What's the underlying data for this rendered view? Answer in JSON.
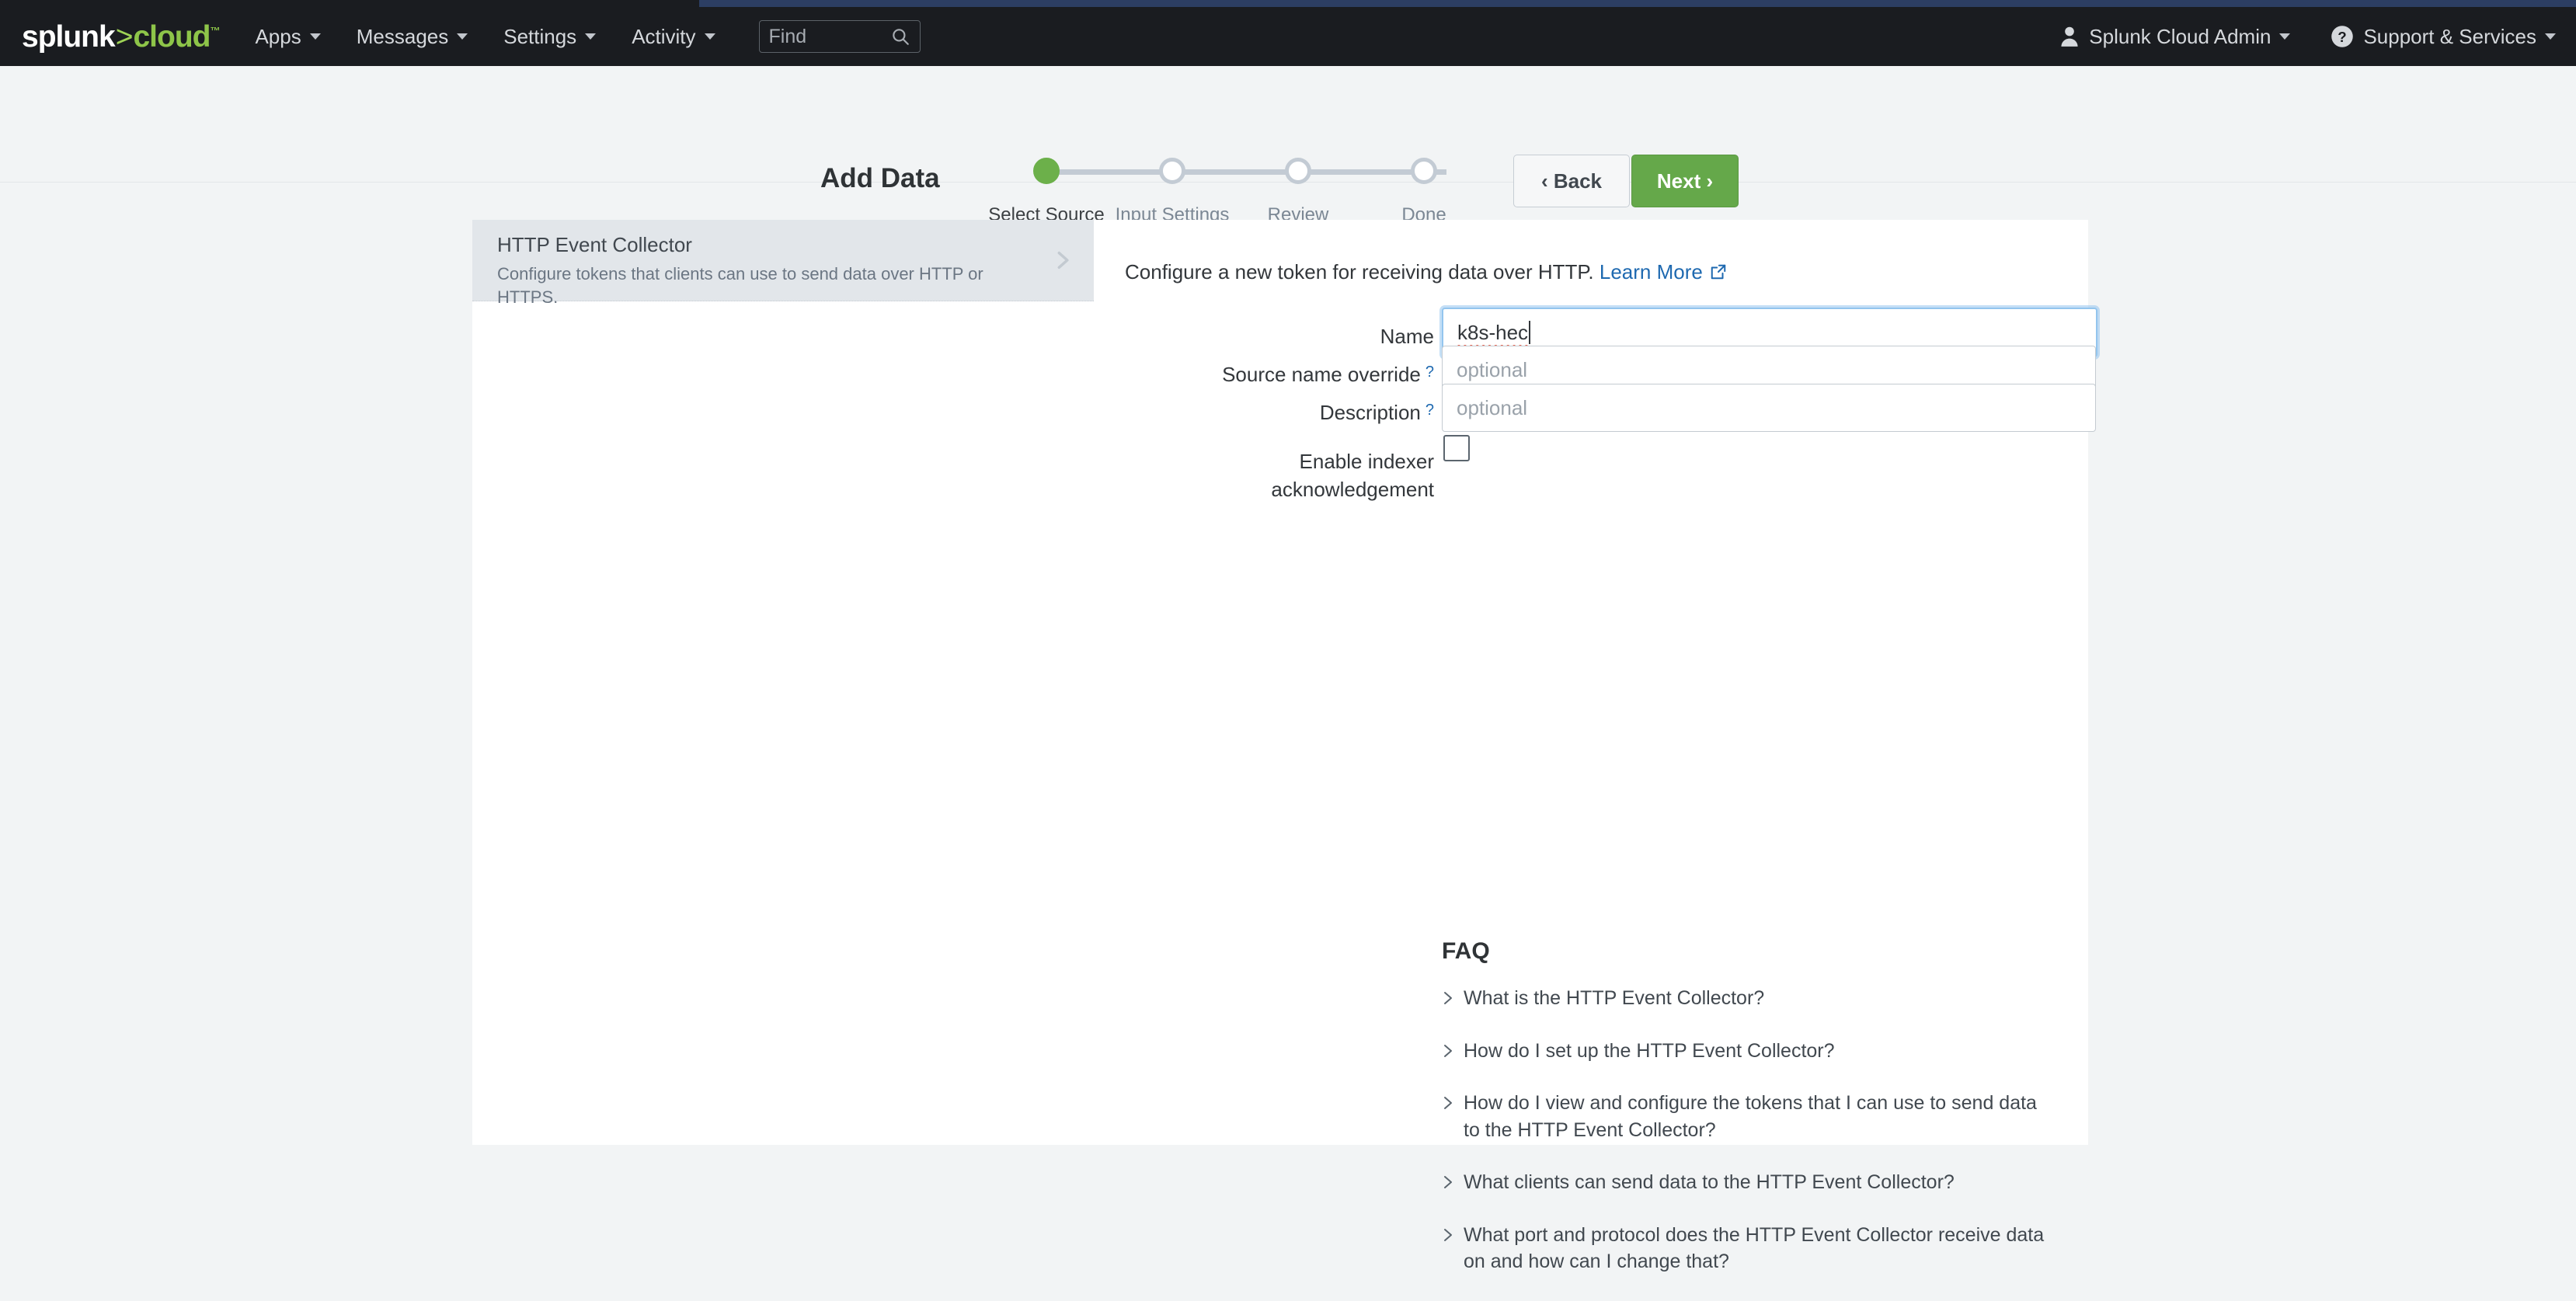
{
  "navbar": {
    "brand": {
      "splunk": "splunk",
      "sep": ">",
      "cloud": "cloud"
    },
    "items": [
      {
        "label": "Apps",
        "icon": "chevron-down-icon"
      },
      {
        "label": "Messages",
        "icon": "chevron-down-icon"
      },
      {
        "label": "Settings",
        "icon": "chevron-down-icon"
      },
      {
        "label": "Activity",
        "icon": "chevron-down-icon"
      }
    ],
    "find": {
      "placeholder": "Find",
      "icon": "search-icon"
    },
    "user": {
      "label": "Splunk Cloud Admin",
      "icon": "user-icon"
    },
    "support": {
      "label": "Support & Services",
      "icon": "help-circle-icon"
    }
  },
  "wizard": {
    "title": "Add Data",
    "steps": [
      {
        "label": "Select Source",
        "active": true
      },
      {
        "label": "Input Settings",
        "active": false
      },
      {
        "label": "Review",
        "active": false
      },
      {
        "label": "Done",
        "active": false
      }
    ],
    "back_label": "‹ Back",
    "next_label": "Next ›",
    "accent_green": "#65a84a"
  },
  "source_panel": {
    "items": [
      {
        "title": "HTTP Event Collector",
        "description": "Configure tokens that clients can use to send data over HTTP or HTTPS.",
        "selected": true,
        "icon": "chevron-right-icon"
      }
    ]
  },
  "main": {
    "intro_text": "Configure a new token for receiving data over HTTP.",
    "learn_more_label": "Learn More",
    "learn_more_icon": "external-link-icon",
    "fields": [
      {
        "label": "Name",
        "has_help": false,
        "value": "k8s-hec",
        "placeholder": "",
        "focused": true,
        "spellcheck_error": true
      },
      {
        "label": "Source name override",
        "has_help": true,
        "value": "",
        "placeholder": "optional",
        "focused": false,
        "spellcheck_error": false
      },
      {
        "label": "Description",
        "has_help": true,
        "value": "",
        "placeholder": "optional",
        "focused": false,
        "spellcheck_error": false
      }
    ],
    "checkbox": {
      "label_line1": "Enable indexer",
      "label_line2": "acknowledgement",
      "checked": false
    },
    "faq": {
      "title": "FAQ",
      "items": [
        "What is the HTTP Event Collector?",
        "How do I set up the HTTP Event Collector?",
        "How do I view and configure the tokens that I can use to send data to the HTTP Event Collector?",
        "What clients can send data to the HTTP Event Collector?",
        "What port and protocol does the HTTP Event Collector receive data on and how can I change that?"
      ]
    }
  },
  "colors": {
    "nav_bg": "#1a1c20",
    "top_strip": "#2c3e63",
    "page_bg": "#f2f4f5",
    "link_blue": "#1e69b0",
    "green": "#65a84a",
    "selected_row": "#e2e6ea"
  }
}
